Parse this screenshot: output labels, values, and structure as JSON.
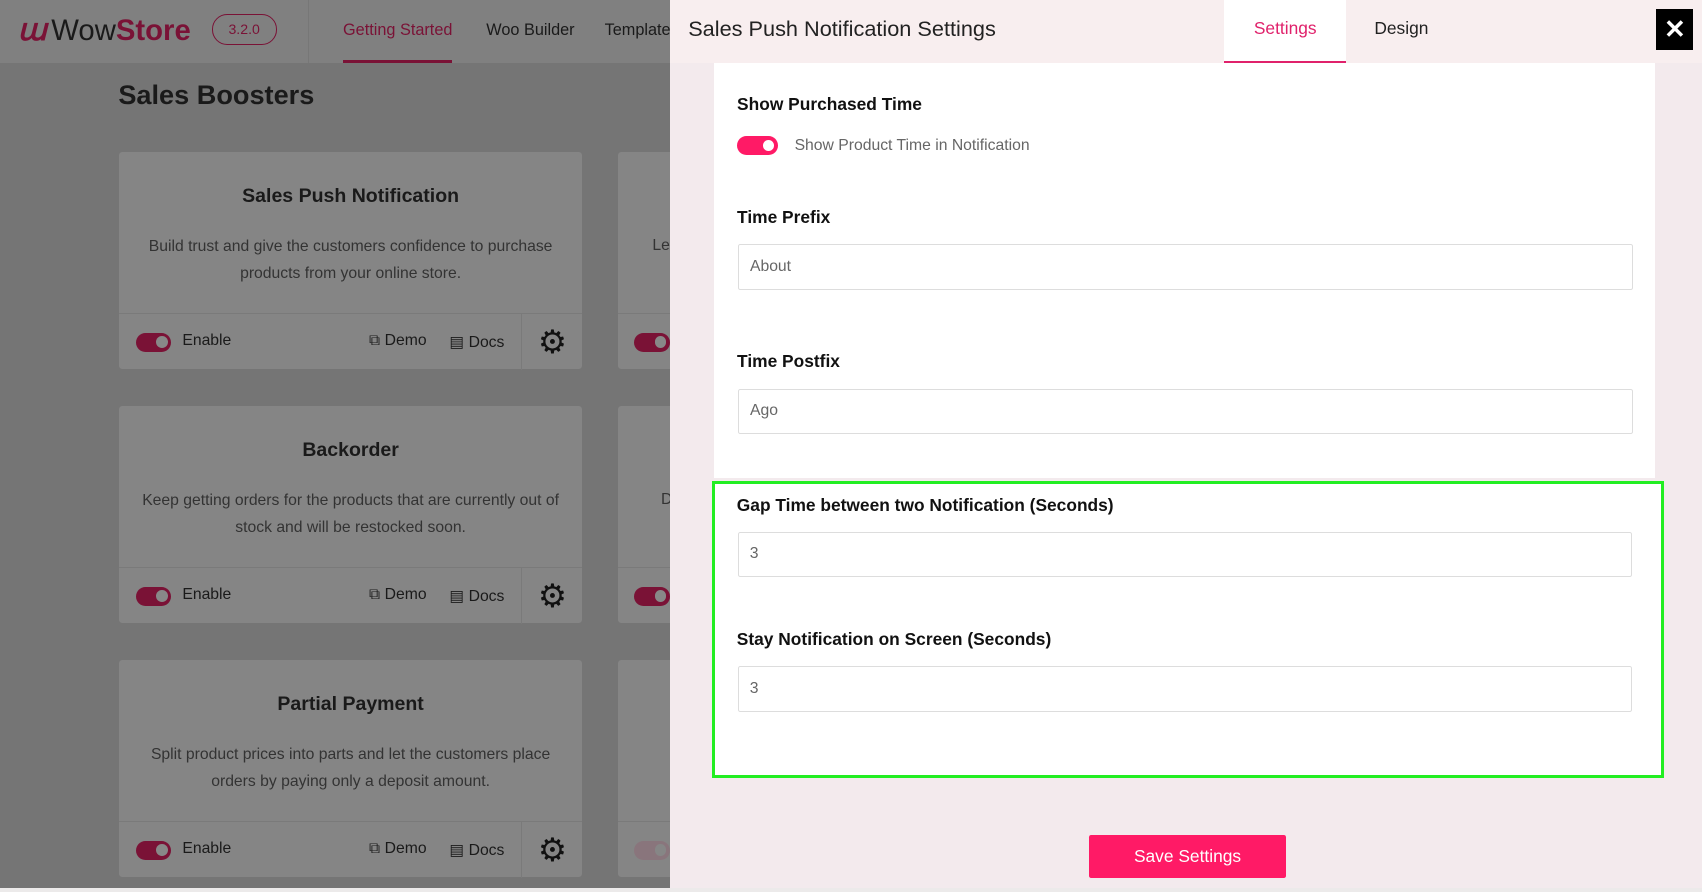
{
  "header": {
    "logo_prefix": "Wow",
    "logo_suffix": "Store",
    "version": "3.2.0",
    "nav": [
      "Getting Started",
      "Woo Builder",
      "Template"
    ]
  },
  "page_title": "Sales Boosters",
  "cards": [
    {
      "title": "Sales Push Notification",
      "desc": "Build trust and give the customers confidence to purchase products from your online store.",
      "enabled": true
    },
    {
      "title": "Backorder",
      "desc": "Keep getting orders for the products that are currently out of stock and will be restocked soon.",
      "enabled": true
    },
    {
      "title": "Partial Payment",
      "desc": "Split product prices into parts and let the customers place orders by paying only a deposit amount.",
      "enabled": true
    }
  ],
  "cards_right_partial": [
    "Le",
    "D",
    ""
  ],
  "card_labels": {
    "enable": "Enable",
    "demo": "Demo",
    "docs": "Docs"
  },
  "modal": {
    "title": "Sales Push Notification Settings",
    "tabs": [
      "Settings",
      "Design"
    ],
    "active_tab": "Settings",
    "close": "✕",
    "show_time": {
      "label": "Show Purchased Time",
      "toggle_label": "Show Product Time in Notification",
      "on": true
    },
    "time_prefix": {
      "label": "Time Prefix",
      "value": "About"
    },
    "time_postfix": {
      "label": "Time Postfix",
      "value": "Ago"
    },
    "gap_time": {
      "label": "Gap Time between two Notification (Seconds)",
      "value": "3"
    },
    "stay_time": {
      "label": "Stay Notification on Screen (Seconds)",
      "value": "3"
    },
    "save": "Save Settings"
  },
  "colors": {
    "accent": "#ff1a66",
    "highlight": "#22ee22",
    "brand": "#7a1236"
  }
}
